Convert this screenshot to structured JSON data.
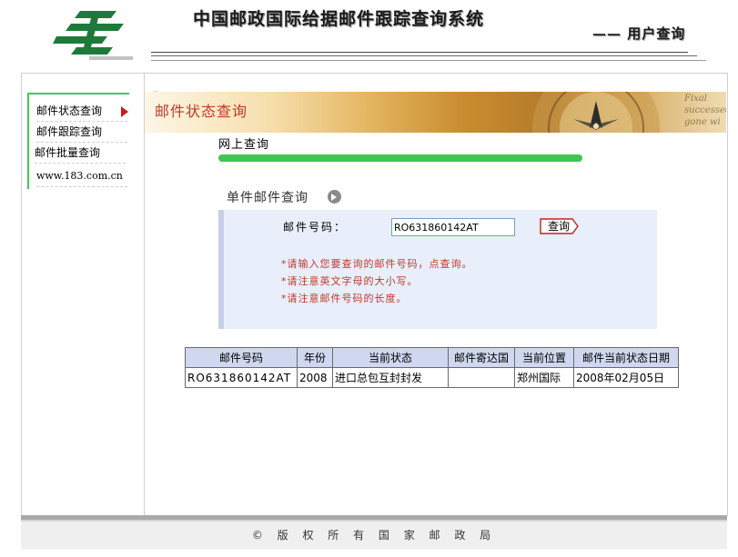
{
  "header": {
    "system_title": "中国邮政国际给据邮件跟踪查询系统",
    "user_query": "—— 用户查询"
  },
  "sidebar": {
    "items": [
      {
        "label": "邮件状态查询"
      },
      {
        "label": "邮件跟踪查询"
      },
      {
        "label": "邮件批量查询"
      },
      {
        "label": "www.183.com.cn"
      }
    ]
  },
  "banner": {
    "title": "邮件状态查询",
    "script_text": "Fixal successed gone wi"
  },
  "query": {
    "online_title": "网上查询",
    "single_title": "单件邮件查询",
    "field_label": "邮件号码：",
    "field_value": "RO631860142AT",
    "button_label": "查询",
    "hints": [
      "*请输入您要查询的邮件号码，点查询。",
      "*请注意英文字母的大小写。",
      "*请注意邮件号码的长度。"
    ]
  },
  "results": {
    "columns": [
      "邮件号码",
      "年份",
      "当前状态",
      "邮件寄达国",
      "当前位置",
      "邮件当前状态日期"
    ],
    "rows": [
      [
        "RO631860142AT",
        "2008",
        "进口总包互封封发",
        "",
        "郑州国际",
        "2008年02月05日"
      ]
    ]
  },
  "footer": {
    "copyright": "© 版 权 所 有 国 家 邮 政 局"
  },
  "colors": {
    "accent_green": "#3fc552",
    "hint_red": "#c0392b",
    "panel_bg": "#e8eefa",
    "table_header_bg": "#cfd8ef"
  }
}
